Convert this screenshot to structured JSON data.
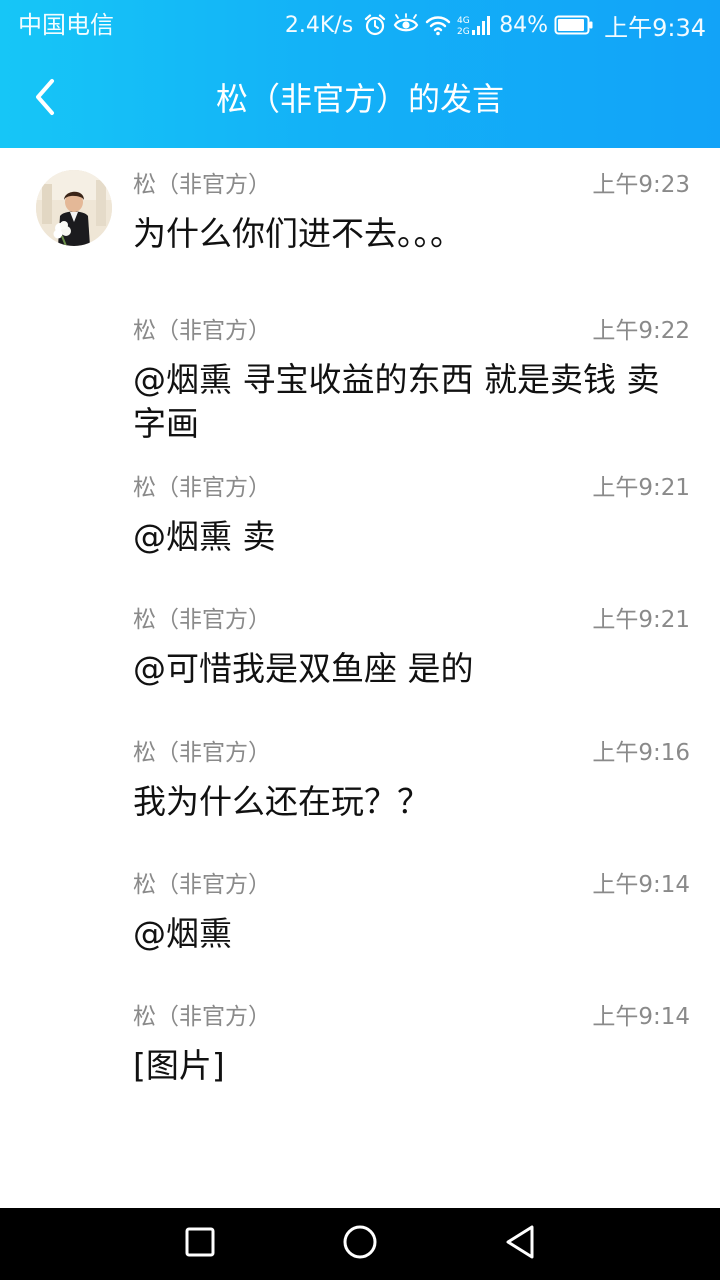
{
  "status_bar": {
    "carrier": "中国电信",
    "net_speed": "2.4K/s",
    "battery": "84%",
    "time": "上午9:34",
    "icons": [
      "alarm-icon",
      "eye-icon",
      "wifi-icon",
      "signal-4g-icon",
      "battery-icon"
    ]
  },
  "header": {
    "title": "松（非官方）的发言",
    "back_icon": "chevron-left-icon",
    "background_colors": [
      "#16c6f7",
      "#12a3f8"
    ]
  },
  "messages": [
    {
      "name": "松（非官方）",
      "time": "上午9:23",
      "text": "为什么你们进不去。。。",
      "has_avatar": true
    },
    {
      "name": "松（非官方）",
      "time": "上午9:22",
      "text": "@烟熏 寻宝收益的东西 就是卖钱 卖字画",
      "has_avatar": false
    },
    {
      "name": "松（非官方）",
      "time": "上午9:21",
      "text": "@烟熏 卖",
      "has_avatar": false
    },
    {
      "name": "松（非官方）",
      "time": "上午9:21",
      "text": "@可惜我是双鱼座 是的",
      "has_avatar": false
    },
    {
      "name": "松（非官方）",
      "time": "上午9:16",
      "text": "我为什么还在玩？？",
      "has_avatar": false
    },
    {
      "name": "松（非官方）",
      "time": "上午9:14",
      "text": "@烟熏",
      "has_avatar": false
    },
    {
      "name": "松（非官方）",
      "time": "上午9:14",
      "text": "[图片]",
      "has_avatar": false
    }
  ],
  "nav_bar": {
    "icons": [
      "recent-apps-icon",
      "home-icon",
      "back-icon"
    ]
  }
}
